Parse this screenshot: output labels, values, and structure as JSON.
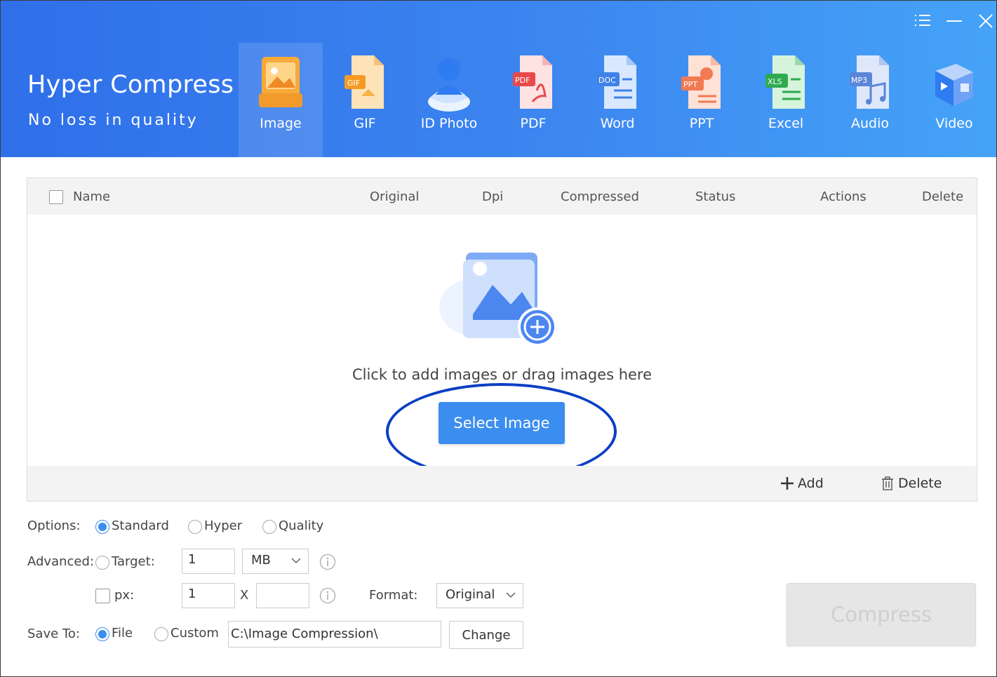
{
  "app": {
    "title": "Hyper Compress",
    "subtitle": "No loss in quality"
  },
  "window_controls": {
    "menu_icon": "menu-icon",
    "minimize_icon": "minimize-icon",
    "close_icon": "close-icon"
  },
  "tabs": [
    {
      "label": "Image",
      "icon": "image-file-icon",
      "active": true
    },
    {
      "label": "GIF",
      "icon": "gif-file-icon"
    },
    {
      "label": "ID Photo",
      "icon": "id-photo-icon"
    },
    {
      "label": "PDF",
      "icon": "pdf-file-icon"
    },
    {
      "label": "Word",
      "icon": "word-file-icon"
    },
    {
      "label": "PPT",
      "icon": "ppt-file-icon"
    },
    {
      "label": "Excel",
      "icon": "excel-file-icon"
    },
    {
      "label": "Audio",
      "icon": "audio-file-icon"
    },
    {
      "label": "Video",
      "icon": "video-file-icon"
    }
  ],
  "table": {
    "columns": [
      "Name",
      "Original",
      "Dpi",
      "Compressed",
      "Status",
      "Actions",
      "Delete"
    ]
  },
  "empty_state": {
    "text": "Click to add images or drag images here",
    "button": "Select Image"
  },
  "footer_actions": {
    "add": "Add",
    "delete": "Delete"
  },
  "options": {
    "label": "Options:",
    "modes": [
      "Standard",
      "Hyper",
      "Quality"
    ],
    "selected": "Standard"
  },
  "advanced": {
    "label": "Advanced:",
    "target_label": "Target:",
    "target_value": "1",
    "unit": "MB",
    "px_label": "px:",
    "px_width": "1",
    "px_x": "X",
    "px_height": "",
    "format_label": "Format:",
    "format_value": "Original"
  },
  "save_to": {
    "label": "Save To:",
    "file_label": "File",
    "custom_label": "Custom",
    "selected": "File",
    "path": "C:\\Image Compression\\",
    "change_button": "Change"
  },
  "compress_button": "Compress",
  "colors": {
    "accent": "#3b8ef0",
    "header_start": "#2f6fe9",
    "header_end": "#45a3f7",
    "annotation": "#0a3fc4"
  }
}
